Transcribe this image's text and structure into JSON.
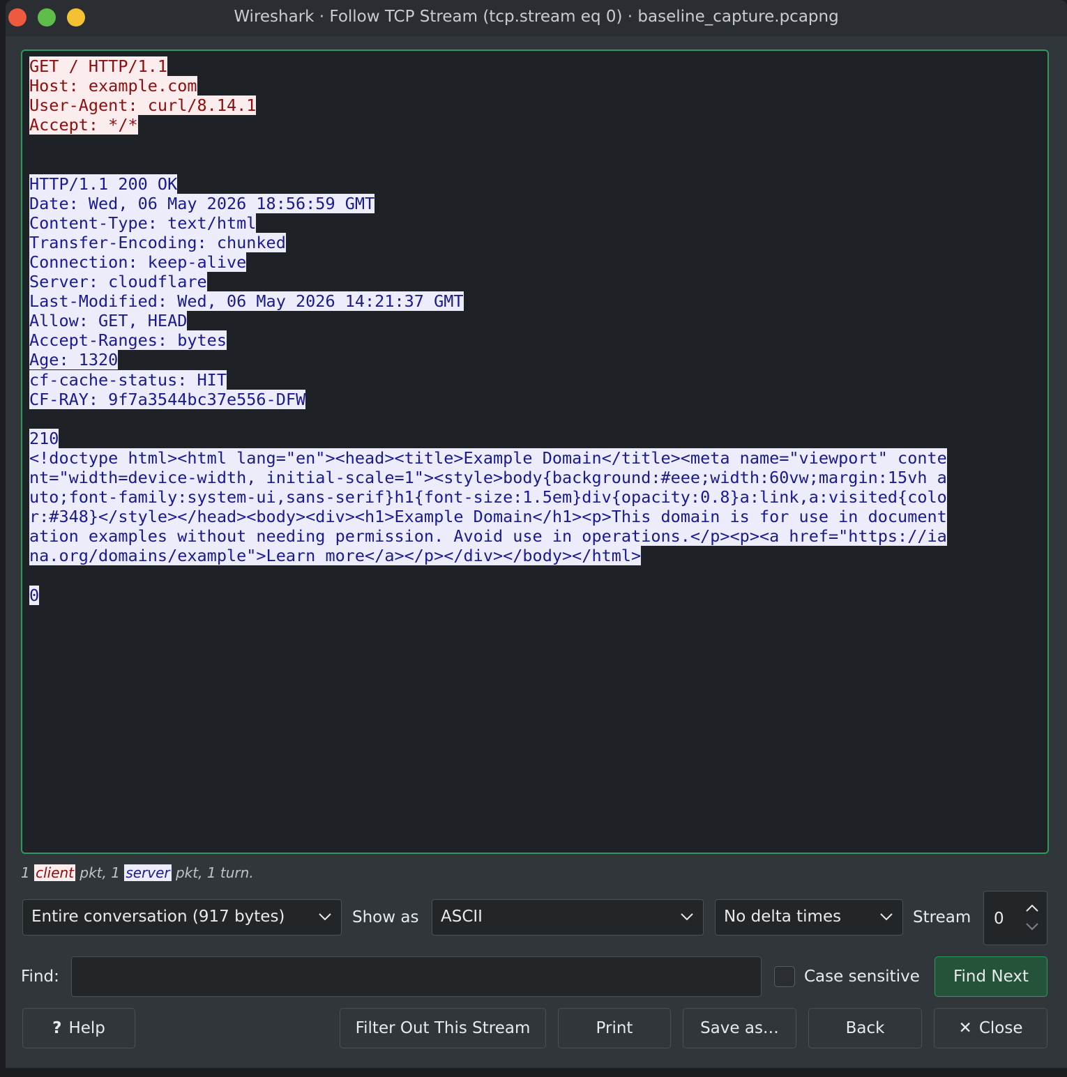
{
  "window": {
    "title": "Wireshark · Follow TCP Stream (tcp.stream eq 0) · baseline_capture.pcapng"
  },
  "stream": {
    "lines": [
      {
        "text": "GET / HTTP/1.1",
        "dir": "client"
      },
      {
        "text": "Host: example.com",
        "dir": "client"
      },
      {
        "text": "User-Agent: curl/8.14.1",
        "dir": "client"
      },
      {
        "text": "Accept: */*",
        "dir": "client"
      },
      {
        "text": "",
        "dir": ""
      },
      {
        "text": "",
        "dir": ""
      },
      {
        "text": "HTTP/1.1 200 OK",
        "dir": "server"
      },
      {
        "text": "Date: Wed, 06 May 2026 18:56:59 GMT",
        "dir": "server"
      },
      {
        "text": "Content-Type: text/html",
        "dir": "server"
      },
      {
        "text": "Transfer-Encoding: chunked",
        "dir": "server"
      },
      {
        "text": "Connection: keep-alive",
        "dir": "server"
      },
      {
        "text": "Server: cloudflare",
        "dir": "server"
      },
      {
        "text": "Last-Modified: Wed, 06 May 2026 14:21:37 GMT",
        "dir": "server"
      },
      {
        "text": "Allow: GET, HEAD",
        "dir": "server"
      },
      {
        "text": "Accept-Ranges: bytes",
        "dir": "server"
      },
      {
        "text": "Age: 1320",
        "dir": "server"
      },
      {
        "text": "cf-cache-status: HIT",
        "dir": "server"
      },
      {
        "text": "CF-RAY: 9f7a3544bc37e556-DFW",
        "dir": "server"
      },
      {
        "text": "",
        "dir": ""
      },
      {
        "text": "210",
        "dir": "server"
      },
      {
        "text": "<!doctype html><html lang=\"en\"><head><title>Example Domain</title><meta name=\"viewport\" conte",
        "dir": "server"
      },
      {
        "text": "nt=\"width=device-width, initial-scale=1\"><style>body{background:#eee;width:60vw;margin:15vh a",
        "dir": "server"
      },
      {
        "text": "uto;font-family:system-ui,sans-serif}h1{font-size:1.5em}div{opacity:0.8}a:link,a:visited{colo",
        "dir": "server"
      },
      {
        "text": "r:#348}</style></head><body><div><h1>Example Domain</h1><p>This domain is for use in document",
        "dir": "server"
      },
      {
        "text": "ation examples without needing permission. Avoid use in operations.</p><p><a href=\"https://ia",
        "dir": "server"
      },
      {
        "text": "na.org/domains/example\">Learn more</a></p></div></body></html>",
        "dir": "server"
      },
      {
        "text": "",
        "dir": ""
      },
      {
        "text": "0",
        "dir": "server"
      }
    ]
  },
  "summary": {
    "prefix": "1 ",
    "client_tag": "client",
    "middle": " pkt, 1 ",
    "server_tag": "server",
    "suffix": " pkt, 1 turn."
  },
  "controls": {
    "conversation": "Entire conversation (917 bytes)",
    "show_as_label": "Show as",
    "show_as_value": "ASCII",
    "delta": "No delta times",
    "stream_label": "Stream",
    "stream_value": "0"
  },
  "find": {
    "label": "Find:",
    "value": "",
    "case_sensitive_label": "Case sensitive",
    "case_sensitive_checked": false,
    "find_next": "Find Next"
  },
  "buttons": {
    "help": "Help",
    "filter_out": "Filter Out This Stream",
    "print": "Print",
    "save_as": "Save as…",
    "back": "Back",
    "close": "Close"
  },
  "colors": {
    "client_bg": "#fbeded",
    "client_fg": "#8c0e0e",
    "server_bg": "#ececfb",
    "server_fg": "#1a1a8f",
    "accent": "#2e9b5c"
  }
}
